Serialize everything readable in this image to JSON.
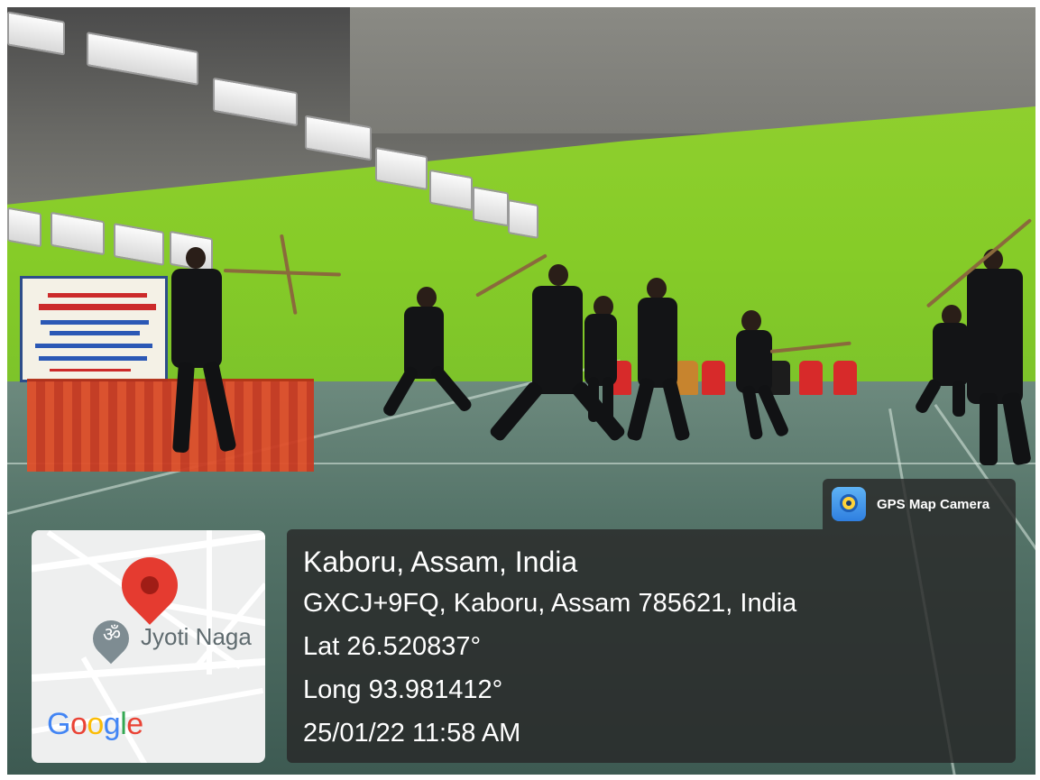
{
  "overlay": {
    "badge_label": "GPS Map Camera",
    "badge_icon": "gps-map-camera-logo-icon",
    "place_title": "Kaboru, Assam, India",
    "address": "GXCJ+9FQ, Kaboru, Assam 785621, India",
    "latitude": "Lat 26.520837°",
    "longitude": "Long 93.981412°",
    "datetime": "25/01/22 11:58 AM"
  },
  "map": {
    "poi_label": "Jyoti Naga",
    "poi_icon": "om-place-icon",
    "pin_icon": "location-pin-icon",
    "logo": "Google"
  },
  "colors": {
    "overlay_bg": "#282828",
    "wall_green": "#86cc28",
    "pin_red": "#e53b30"
  }
}
